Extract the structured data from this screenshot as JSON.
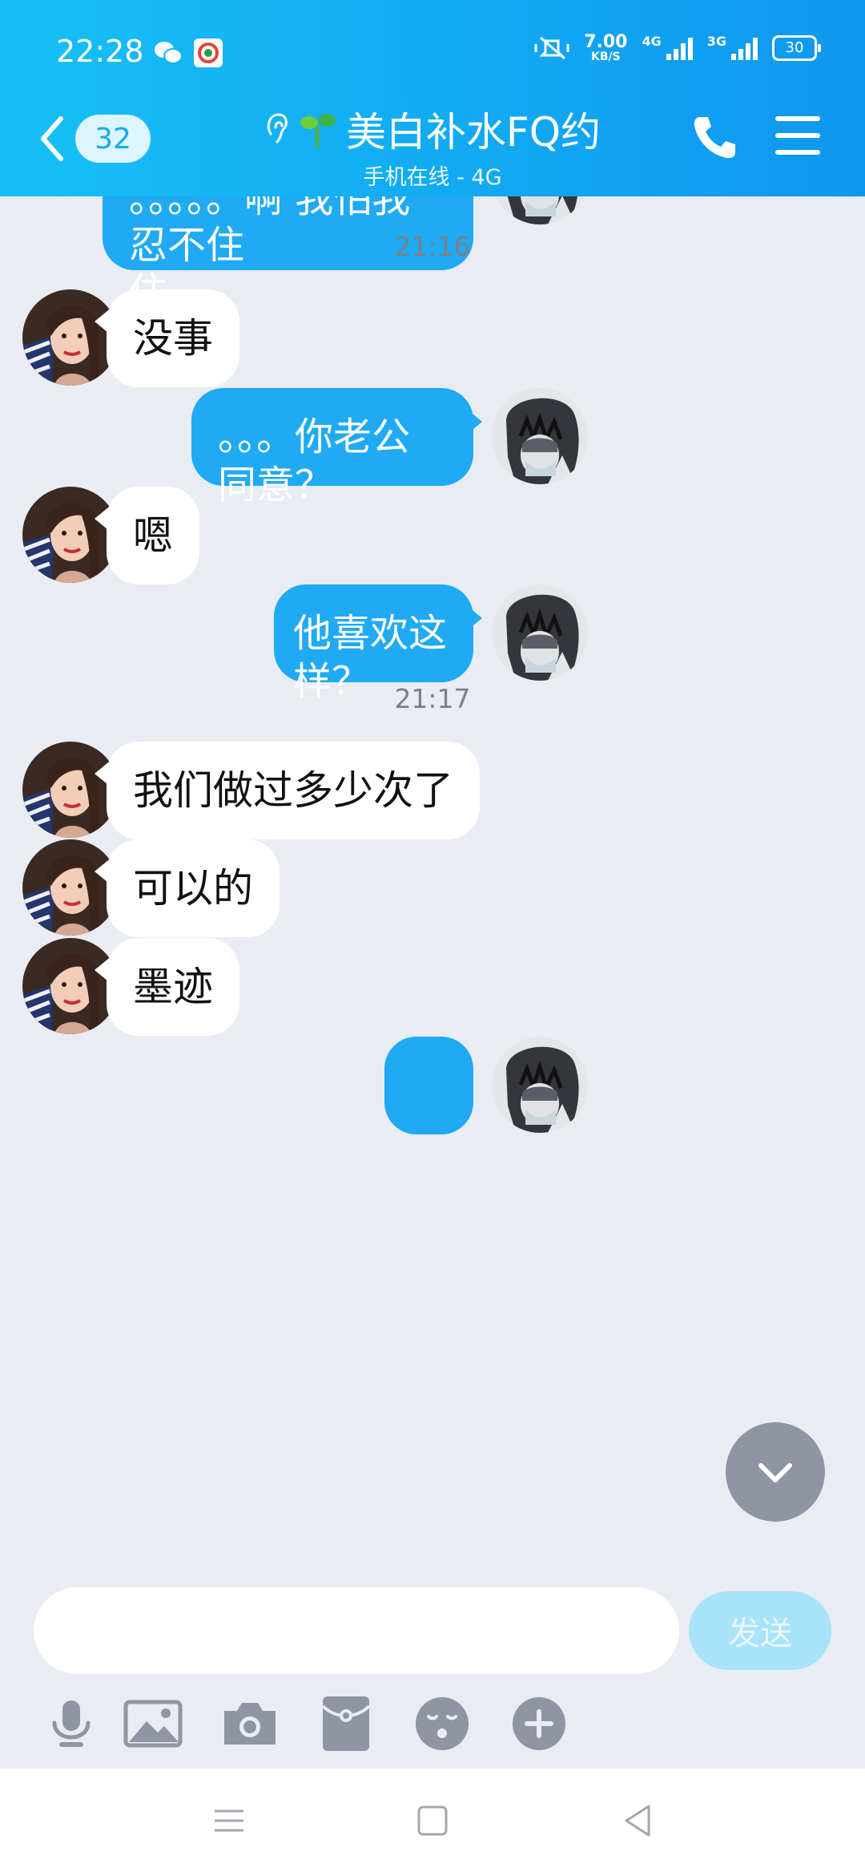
{
  "status_bar": {
    "time": "22:28",
    "net_speed": "7.00",
    "net_speed_unit": "KB/S",
    "net_type_1": "4G",
    "net_type_2": "3G",
    "battery": "30"
  },
  "header": {
    "unread_count": "32",
    "contact_name": "美白补水FQ约",
    "contact_status": "手机在线 - 4G"
  },
  "messages": [
    {
      "side": "out",
      "text": "。。。。。啊   我怕我忍不住",
      "wrap_text": "住"
    },
    {
      "kind": "time",
      "text": "21:16"
    },
    {
      "side": "in",
      "text": "没事"
    },
    {
      "side": "out",
      "text": "。。。你老公同意？"
    },
    {
      "side": "in",
      "text": "嗯"
    },
    {
      "side": "out",
      "text": "他喜欢这样？"
    },
    {
      "kind": "time",
      "text": "21:17"
    },
    {
      "side": "in",
      "text": "我们做过多少次了"
    },
    {
      "side": "in",
      "text": "可以的"
    },
    {
      "side": "in",
      "text": "墨迹"
    }
  ],
  "input": {
    "placeholder": "",
    "send_label": "发送"
  },
  "toolbar": [
    "mic-icon",
    "image-icon",
    "camera-icon",
    "red-packet-icon",
    "emoji-icon",
    "plus-icon"
  ],
  "colors": {
    "header": "#12a9f2",
    "bubble_out": "#1faaf3",
    "bubble_in": "#ffffff",
    "background": "#e9ecf3"
  }
}
